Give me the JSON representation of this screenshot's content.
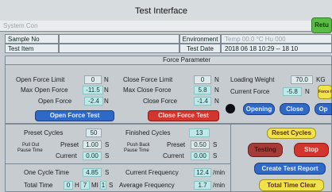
{
  "window": {
    "title": "Test Interface",
    "system_label": "System Con",
    "return_btn": "Retu"
  },
  "info": {
    "sample_no_label": "Sample No",
    "test_item_label": "Test Item",
    "environment_label": "Environment",
    "environment_value": "Temp 00.0 °C  Hu 000 ",
    "test_date_label": "Test Date",
    "test_date_value": "2018 06 18 10:29 -- 18 10"
  },
  "force_parameter": {
    "title": "Force Parameter",
    "open_force_limit": {
      "label": "Open Force Limit",
      "value": "0",
      "unit": "N"
    },
    "max_open_force": {
      "label": "Max Open Force",
      "value": "-11.5",
      "unit": "N"
    },
    "open_force": {
      "label": "Open Force",
      "value": "-2.4",
      "unit": "N"
    },
    "close_force_limit": {
      "label": "Close Force Limit",
      "value": "0",
      "unit": "N"
    },
    "max_close_force": {
      "label": "Max Close Force",
      "value": "5.8",
      "unit": "N"
    },
    "close_force": {
      "label": "Close Force",
      "value": "-1.4",
      "unit": "N"
    },
    "loading_weight": {
      "label": "Loading Weight",
      "value": "70.0",
      "unit": "KG"
    },
    "current_force": {
      "label": "Current Force",
      "value": "-5.8",
      "unit": "N"
    },
    "force_re_label": "Force Re",
    "open_force_test_btn": "Open Force Test",
    "close_force_test_btn": "Close Force Test",
    "opening_btn": "Opening",
    "close_btn": "Close",
    "open_btn_partial": "Op"
  },
  "cycles": {
    "preset_cycles_label": "Preset Cycles",
    "preset_cycles_value": "50",
    "finished_cycles_label": "Finished Cycles",
    "finished_cycles_value": "13",
    "pull_out_label_1": "Pull Out",
    "pull_out_label_2": "Pause Time",
    "push_back_label_1": "Push Back",
    "push_back_label_2": "Pause Time",
    "preset_label": "Preset",
    "current_label": "Current",
    "pull_preset_value": "1.00",
    "pull_current_value": "0.00",
    "push_preset_value": "0.50",
    "push_current_value": "0.00",
    "sec_unit": "S",
    "one_cycle_time_label": "One Cycle Time",
    "one_cycle_time_value": "4.85",
    "current_frequency_label": "Current Frequency",
    "current_frequency_value": "12.4",
    "total_time_label": "Total Time",
    "total_time_h_value": "0",
    "total_time_h_unit": "H",
    "total_time_m_value": "7",
    "total_time_m_unit": "MI",
    "total_time_s_value": "1",
    "average_frequency_label": "Average Frequency",
    "average_frequency_value": "1.7",
    "per_min_unit": "/min"
  },
  "actions": {
    "reset_cycles": "Reset Cycles",
    "testing": "Testing",
    "stop": "Stop",
    "create_test_report": "Create Test Report",
    "total_time_clear": "Total Time Clear"
  }
}
